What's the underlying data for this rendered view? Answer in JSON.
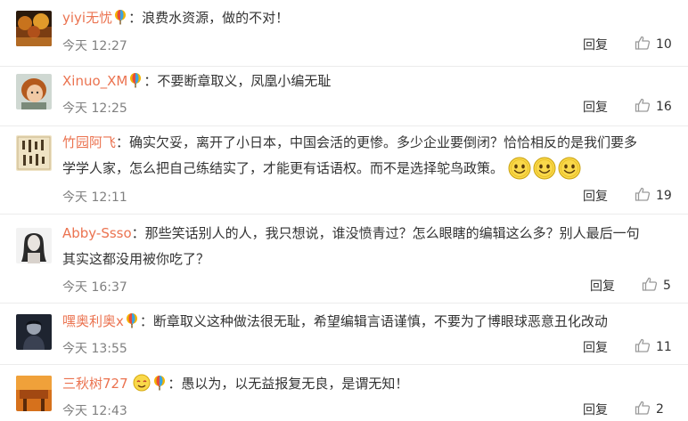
{
  "comments": [
    {
      "username": "yiyi无忧",
      "text": "：浪费水资源，做的不对！",
      "time": "今天 12:27",
      "reply_label": "回复",
      "likes": "10",
      "avatar_icon": "avatar-autumn-icon"
    },
    {
      "username": "Xinuo_XM",
      "text": "：不要断章取义，凤凰小编无耻",
      "time": "今天 12:25",
      "reply_label": "回复",
      "likes": "16",
      "avatar_icon": "avatar-child-icon"
    },
    {
      "username": "竹园阿飞",
      "text_line1": "：确实欠妥，离开了小日本，中国会活的更惨。多少企业要倒闭？恰恰相反的是我们要多",
      "text_line2": "学学人家，怎么把自己练结实了，才能更有话语权。而不是选择鸵鸟政策。",
      "time": "今天 12:11",
      "reply_label": "回复",
      "likes": "19",
      "avatar_icon": "avatar-calligraphy-icon"
    },
    {
      "username": "Abby-Ssso",
      "text_line1": "：那些笑话别人的人，我只想说，谁没愤青过？怎么眼瞎的编辑这么多？别人最后一句",
      "text_line2": "其实这都没用被你吃了？",
      "time": "今天 16:37",
      "reply_label": "回复",
      "likes": "5",
      "avatar_icon": "avatar-sketch-portrait-icon"
    },
    {
      "username": "嘿奥利奥x",
      "text": "：断章取义这种做法很无耻，希望编辑言语谨慎，不要为了博眼球恶意丑化改动",
      "time": "今天 13:55",
      "reply_label": "回复",
      "likes": "11",
      "avatar_icon": "avatar-dark-portrait-icon"
    },
    {
      "username": "三秋树727",
      "text": "：愚以为，以无益报复无良，是谓无知！",
      "time": "今天 12:43",
      "reply_label": "回复",
      "likes": "2",
      "avatar_icon": "avatar-orange-scene-icon"
    }
  ],
  "colors": {
    "username": "#eb7350",
    "time": "#808080",
    "text": "#333333",
    "separator": "#ececec"
  }
}
